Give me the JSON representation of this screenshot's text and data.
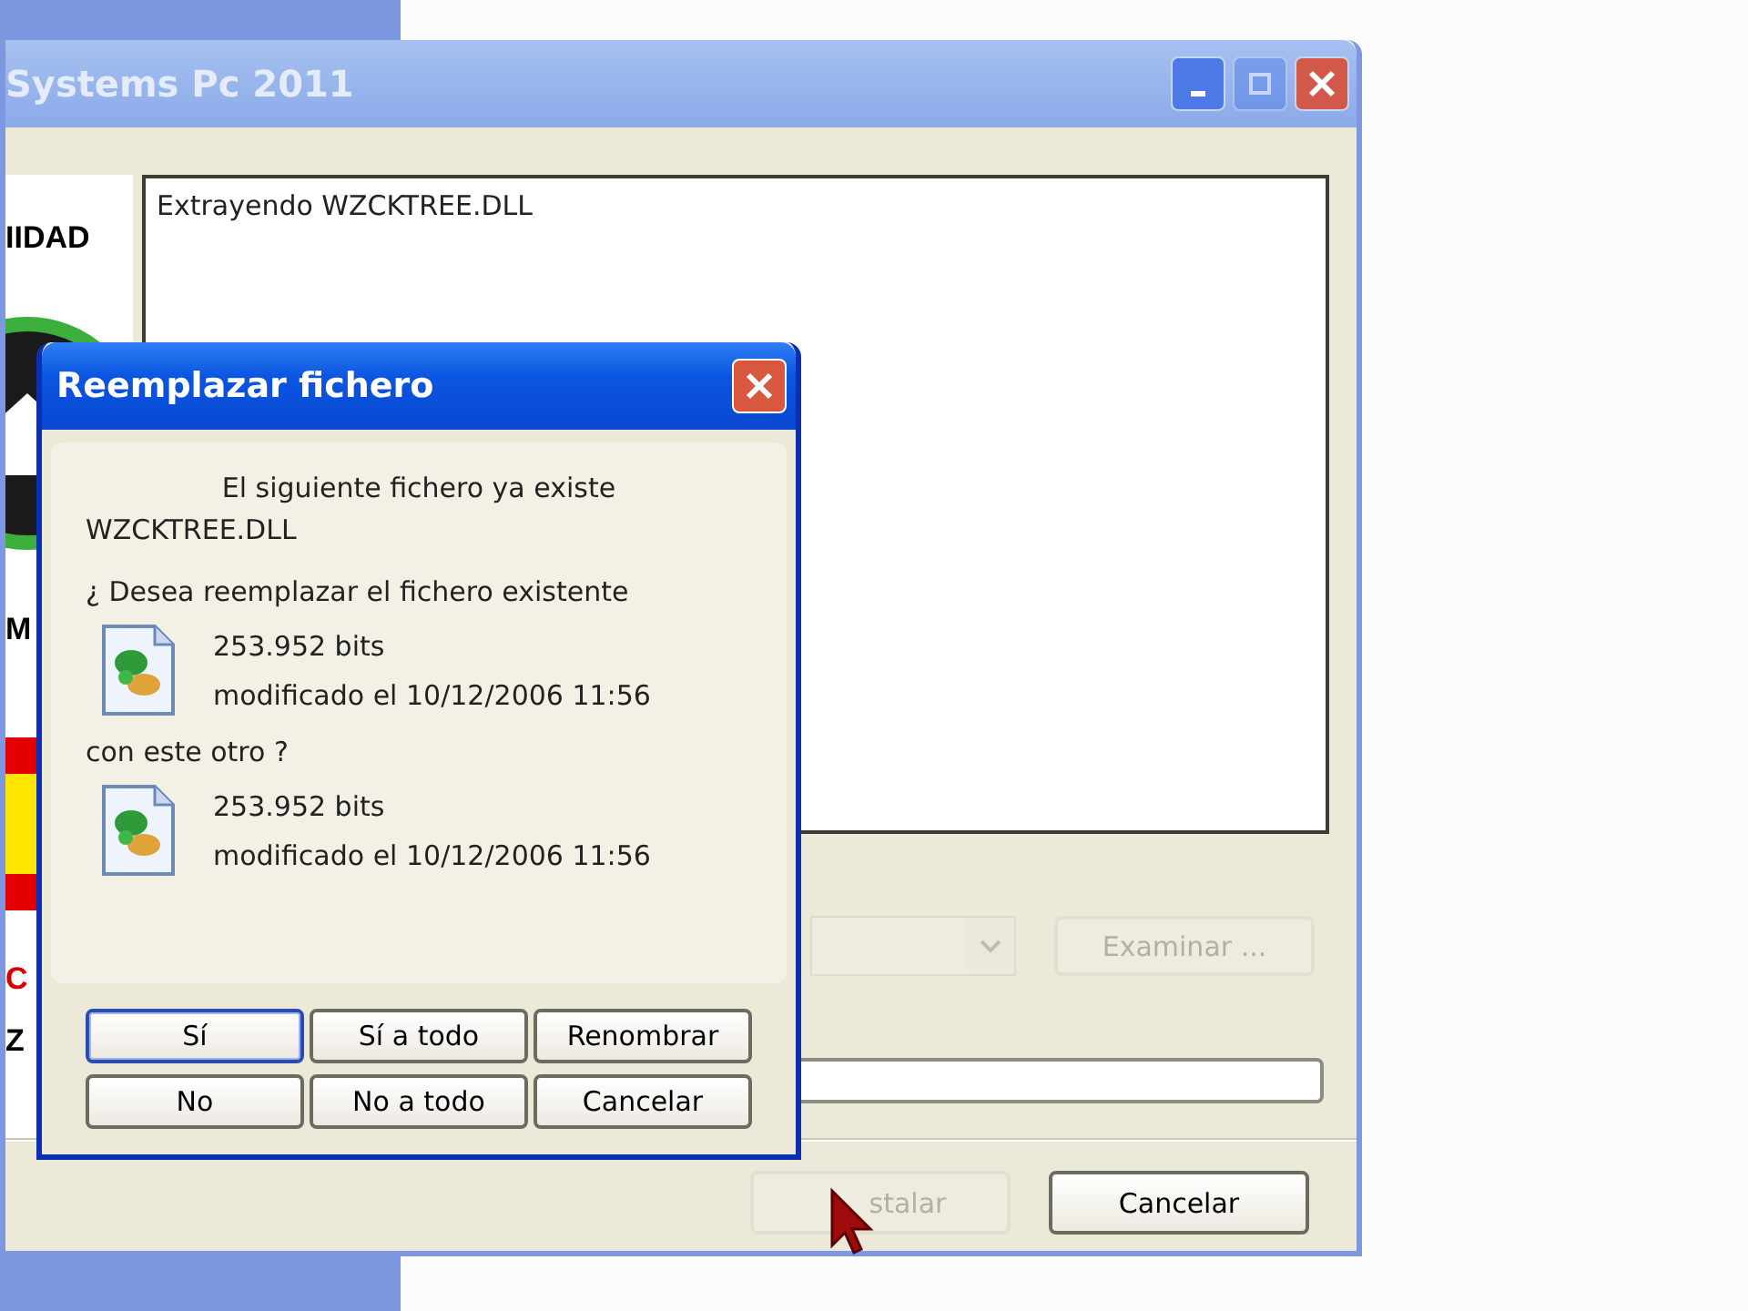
{
  "main_window": {
    "title": "Systems Pc 2011",
    "title_buttons": [
      {
        "kind": "minimize",
        "disabled": false
      },
      {
        "kind": "maximize",
        "disabled": true
      },
      {
        "kind": "close",
        "disabled": false
      }
    ],
    "side_panel": {
      "texts": [
        "IIDAD",
        "M",
        "C",
        "Z"
      ]
    },
    "log": {
      "lines": [
        "Extrayendo WZCKTREE.DLL"
      ]
    },
    "folder_dropdown": {
      "disabled": true
    },
    "browse_button": {
      "label": "Examinar ...",
      "disabled": true
    },
    "progress_bar": {
      "level": 0
    },
    "buttons": [
      {
        "label": "stalar",
        "disabled": true
      },
      {
        "label": "Cancelar",
        "disabled": false
      }
    ]
  },
  "dialog": {
    "title": "Reemplazar fichero",
    "heading": "El siguiente fichero ya existe",
    "filename": "WZCKTREE.DLL",
    "question": "¿ Desea reemplazar el fichero existente",
    "between": "con este otro ?",
    "files": [
      {
        "size": "253.952 bits",
        "modified": "modificado el 10/12/2006 11:56"
      },
      {
        "size": "253.952 bits",
        "modified": "modificado el 10/12/2006 11:56"
      }
    ],
    "buttons": [
      {
        "label": "Sí",
        "selected": true
      },
      {
        "label": "Sí a todo",
        "selected": false
      },
      {
        "label": "Renombrar",
        "selected": false
      },
      {
        "label": "No",
        "selected": false
      },
      {
        "label": "No a todo",
        "selected": false
      },
      {
        "label": "Cancelar",
        "selected": false
      }
    ]
  }
}
